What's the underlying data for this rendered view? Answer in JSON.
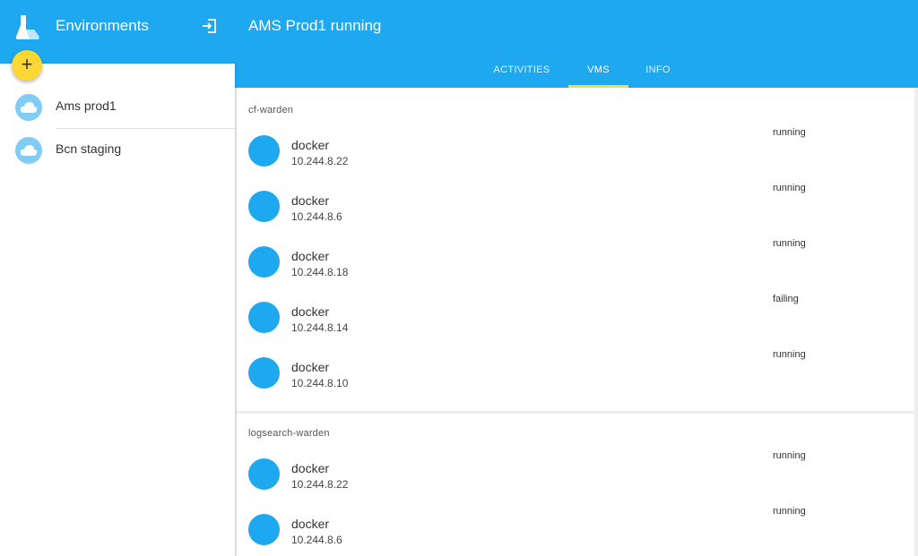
{
  "app": {
    "title": "Environments"
  },
  "page": {
    "title": "AMS Prod1 running"
  },
  "colors": {
    "primary": "#1ea8f0",
    "accent": "#fdd835",
    "env_icon": "#80ccf5"
  },
  "icons": {
    "logo": "flask-logo-icon",
    "exit": "exit-icon",
    "add": "plus-icon",
    "cloud": "cloud-icon"
  },
  "tabs": [
    {
      "label": "ACTIVITIES",
      "active": false
    },
    {
      "label": "VMS",
      "active": true
    },
    {
      "label": "INFO",
      "active": false
    }
  ],
  "fab": {
    "label": "+"
  },
  "environments": [
    {
      "label": "Ams prod1"
    },
    {
      "label": "Bcn staging"
    }
  ],
  "groups": [
    {
      "name": "cf-warden",
      "vms": [
        {
          "name": "docker",
          "ip": "10.244.8.22",
          "status": "running"
        },
        {
          "name": "docker",
          "ip": "10.244.8.6",
          "status": "running"
        },
        {
          "name": "docker",
          "ip": "10.244.8.18",
          "status": "running"
        },
        {
          "name": "docker",
          "ip": "10.244.8.14",
          "status": "failing"
        },
        {
          "name": "docker",
          "ip": "10.244.8.10",
          "status": "running"
        }
      ]
    },
    {
      "name": "logsearch-warden",
      "vms": [
        {
          "name": "docker",
          "ip": "10.244.8.22",
          "status": "running"
        },
        {
          "name": "docker",
          "ip": "10.244.8.6",
          "status": "running"
        }
      ]
    }
  ]
}
